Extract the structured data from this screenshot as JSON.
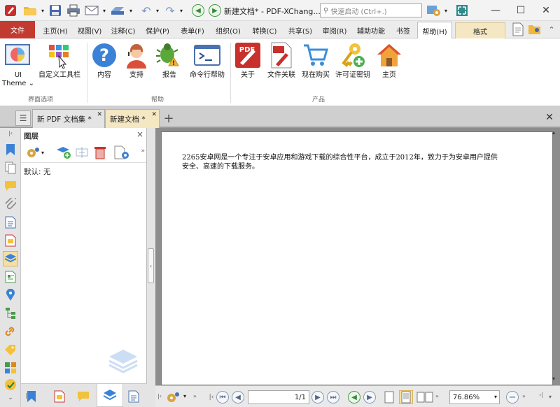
{
  "window": {
    "title": "新建文档* - PDF-XChang...",
    "search_placeholder": "快速启动 (Ctrl+.)",
    "minimize": "—",
    "maximize": "☐",
    "close": "✕"
  },
  "ribbon_tabs": [
    "文件",
    "主页(H)",
    "视图(V)",
    "注释(C)",
    "保护(P)",
    "表单(F)",
    "组织(O)",
    "转换(C)",
    "共享(S)",
    "审阅(R)",
    "辅助功能",
    "书签",
    "帮助(H)",
    "格式"
  ],
  "ribbon_active_tab": "帮助(H)",
  "ribbon": {
    "ui_theme": "UI\nTheme",
    "custom_toolbar": "自定义工具栏",
    "contents": "内容",
    "support": "支持",
    "report": "报告",
    "cmdline_help": "命令行帮助",
    "about": "关于",
    "file_assoc": "文件关联",
    "buy_now": "现在购买",
    "license_key": "许可证密钥",
    "home_page": "主页",
    "group_ui": "界面选项",
    "group_help": "帮助",
    "group_product": "产品",
    "pdf_badge": "PDF"
  },
  "doc_tabs": [
    {
      "label": "新 PDF 文档集 *",
      "active": false
    },
    {
      "label": "新建文档 *",
      "active": true
    }
  ],
  "doc_tab_add": "+",
  "doc_tab_close_all": "✕",
  "panel": {
    "title": "图层",
    "default_layer": "默认: 无",
    "close": "×"
  },
  "document": {
    "text_line1": "2265安卓网是一个专注于安卓应用和游戏下载的综合性平台，成立于2012年，致力于为安卓用户提供",
    "text_line2": "安全、高速的下载服务。"
  },
  "status": {
    "page_display": "1/1",
    "zoom": "76.86%"
  },
  "colors": {
    "file_tab": "#c23b30",
    "format_tab": "#f4e7c2",
    "doc_background": "#8d8d8d"
  }
}
